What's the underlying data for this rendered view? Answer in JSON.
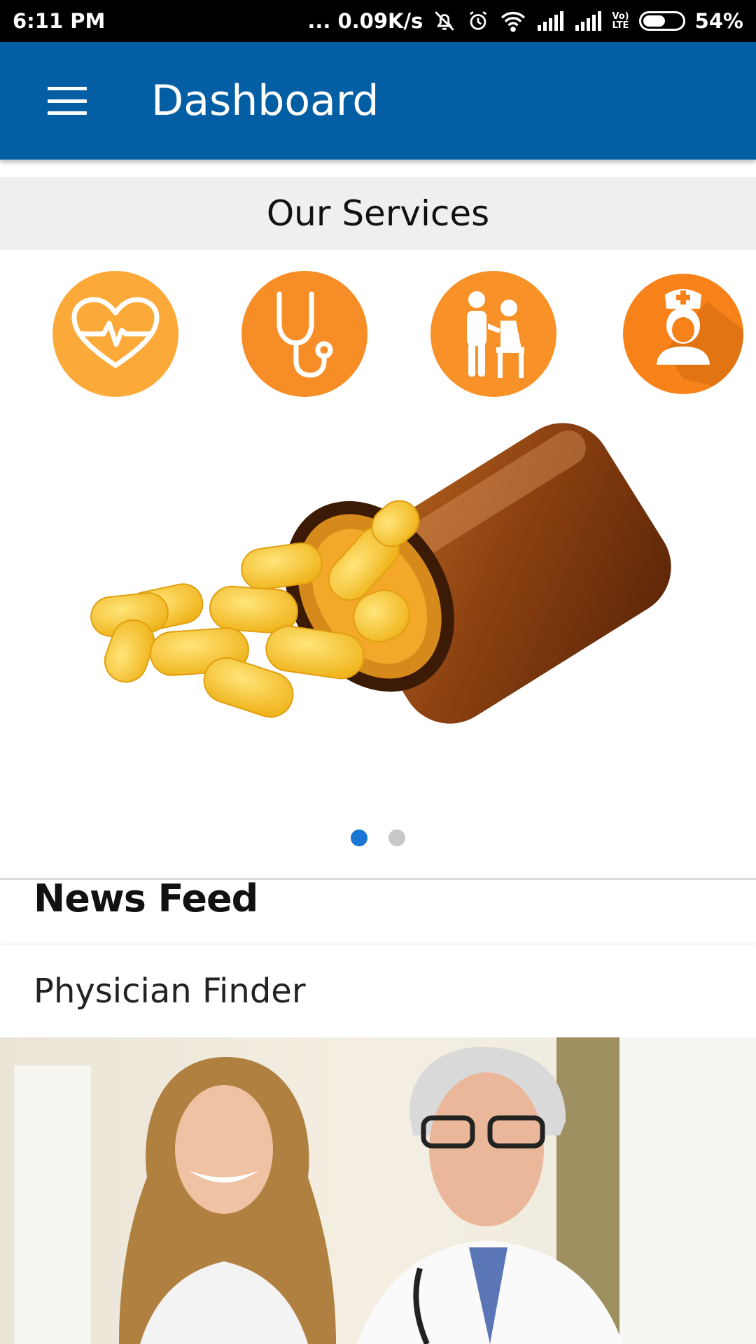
{
  "status_bar": {
    "time": "6:11 PM",
    "network_speed": "... 0.09K/s",
    "battery_percent": "54%",
    "icons": [
      "mute-icon",
      "alarm-icon",
      "wifi-icon",
      "signal-icon",
      "signal-icon",
      "volte-icon",
      "battery-icon"
    ],
    "volte_label_top": "Vo)",
    "volte_label_bottom": "LTE"
  },
  "app_bar": {
    "title": "Dashboard",
    "menu_icon": "hamburger-menu-icon",
    "color": "#045ea4"
  },
  "services": {
    "header": "Our Services",
    "items": [
      {
        "icon": "heart-pulse-icon",
        "color": "#fbaa3a"
      },
      {
        "icon": "stethoscope-icon",
        "color": "#f78d27"
      },
      {
        "icon": "elderly-care-icon",
        "color": "#f79128"
      },
      {
        "icon": "nurse-icon",
        "color": "#f7821a"
      }
    ]
  },
  "carousel": {
    "image": "pill-bottle-image",
    "active_index": 0,
    "dot_count": 2,
    "active_color": "#1976d2",
    "inactive_color": "#c8c8c8"
  },
  "news_feed": {
    "title": "News Feed",
    "items": [
      {
        "label": "Physician Finder",
        "image": "doctors-photo"
      }
    ]
  }
}
